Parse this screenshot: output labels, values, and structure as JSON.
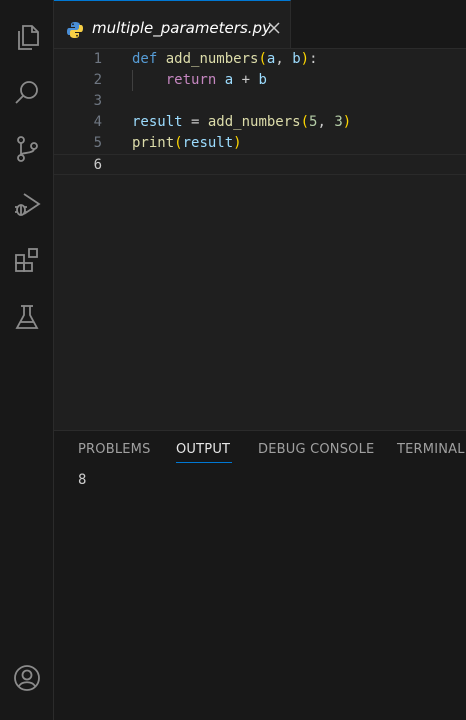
{
  "tab": {
    "filename": "multiple_parameters.py",
    "close_glyph": "✕"
  },
  "editor": {
    "line_numbers": [
      "1",
      "2",
      "3",
      "4",
      "5",
      "6"
    ],
    "active_line": "6",
    "lines": [
      {
        "tokens": [
          [
            "kw",
            "def"
          ],
          [
            "punc",
            " "
          ],
          [
            "fn",
            "add_numbers"
          ],
          [
            "paren",
            "("
          ],
          [
            "var",
            "a"
          ],
          [
            "punc",
            ", "
          ],
          [
            "var",
            "b"
          ],
          [
            "paren",
            ")"
          ],
          [
            "punc",
            ":"
          ]
        ]
      },
      {
        "tokens": [
          [
            "punc",
            "    "
          ],
          [
            "kw2",
            "return"
          ],
          [
            "punc",
            " "
          ],
          [
            "var",
            "a"
          ],
          [
            "punc",
            " + "
          ],
          [
            "var",
            "b"
          ]
        ]
      },
      {
        "tokens": []
      },
      {
        "tokens": [
          [
            "var",
            "result"
          ],
          [
            "punc",
            " = "
          ],
          [
            "fn",
            "add_numbers"
          ],
          [
            "paren",
            "("
          ],
          [
            "num",
            "5"
          ],
          [
            "punc",
            ", "
          ],
          [
            "num",
            "3"
          ],
          [
            "paren",
            ")"
          ]
        ]
      },
      {
        "tokens": [
          [
            "fn",
            "print"
          ],
          [
            "paren",
            "("
          ],
          [
            "var",
            "result"
          ],
          [
            "paren",
            ")"
          ]
        ]
      },
      {
        "tokens": []
      }
    ]
  },
  "panel": {
    "tabs": [
      "PROBLEMS",
      "OUTPUT",
      "DEBUG CONSOLE",
      "TERMINAL"
    ],
    "active_tab": "OUTPUT",
    "output": "8"
  },
  "activity_bar": {
    "icons": [
      "explorer-icon",
      "search-icon",
      "source-control-icon",
      "run-debug-icon",
      "extensions-icon",
      "testing-icon",
      "account-icon"
    ]
  },
  "colors": {
    "accent": "#0078d4",
    "keyword": "#569cd6",
    "control_keyword": "#c586c0",
    "function": "#dcdcaa",
    "variable": "#9cdcfe",
    "number": "#b5cea8",
    "bracket": "#ffd700"
  }
}
